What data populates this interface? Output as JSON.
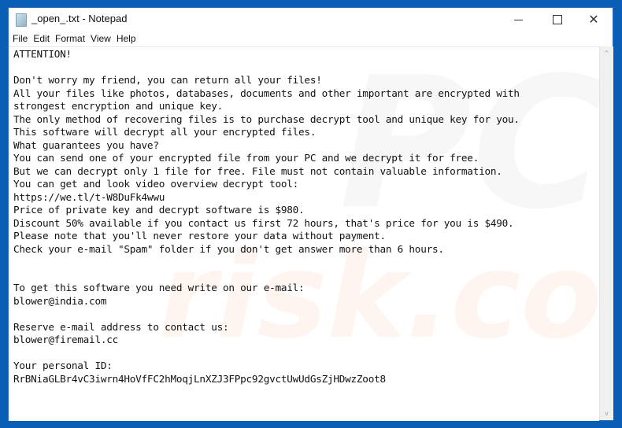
{
  "window": {
    "title": "_open_.txt - Notepad",
    "controls": {
      "minimize": "minimize",
      "maximize": "maximize",
      "close": "✕"
    }
  },
  "menubar": {
    "items": [
      "File",
      "Edit",
      "Format",
      "View",
      "Help"
    ]
  },
  "document": {
    "lines": [
      "ATTENTION!",
      "",
      "Don't worry my friend, you can return all your files!",
      "All your files like photos, databases, documents and other important are encrypted with",
      "strongest encryption and unique key.",
      "The only method of recovering files is to purchase decrypt tool and unique key for you.",
      "This software will decrypt all your encrypted files.",
      "What guarantees you have?",
      "You can send one of your encrypted file from your PC and we decrypt it for free.",
      "But we can decrypt only 1 file for free. File must not contain valuable information.",
      "You can get and look video overview decrypt tool:",
      "https://we.tl/t-W8DuFk4wwu",
      "Price of private key and decrypt software is $980.",
      "Discount 50% available if you contact us first 72 hours, that's price for you is $490.",
      "Please note that you'll never restore your data without payment.",
      "Check your e-mail \"Spam\" folder if you don't get answer more than 6 hours.",
      "",
      "",
      "To get this software you need write on our e-mail:",
      "blower@india.com",
      "",
      "Reserve e-mail address to contact us:",
      "blower@firemail.cc",
      "",
      "Your personal ID:",
      "RrBNiaGLBr4vC3iwrn4HoVfFC2hMoqjLnXZJ3FPpc92gvctUwUdGsZjHDwzZoot8"
    ]
  },
  "watermark": {
    "part1": "PC",
    "part2": "risk.com"
  },
  "scrollbar": {
    "up": "^",
    "down": "v"
  }
}
